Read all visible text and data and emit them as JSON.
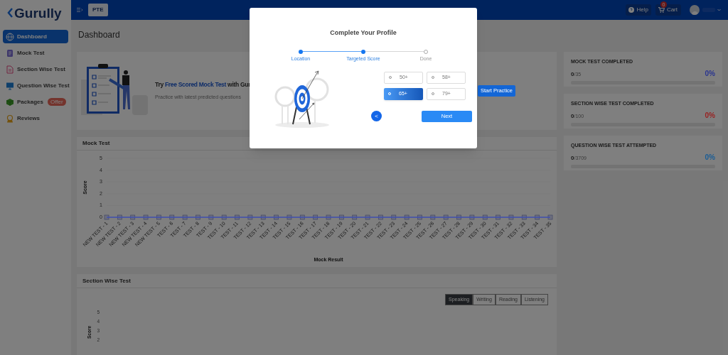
{
  "sidebar": {
    "logo": "Gurully",
    "items": [
      {
        "label": "Dashboard",
        "selected": true
      },
      {
        "label": "Mock Test",
        "selected": false
      },
      {
        "label": "Section Wise Test",
        "selected": false
      },
      {
        "label": "Question Wise Test",
        "selected": false
      },
      {
        "label": "Packages",
        "selected": false,
        "badge": "Offer"
      },
      {
        "label": "Reviews",
        "selected": false
      }
    ]
  },
  "header": {
    "exam_button": "PTE",
    "help": "Help",
    "cart": "Cart",
    "cart_count": "0"
  },
  "page_title": "Dashboard",
  "banner": {
    "title_before": "Try ",
    "title_highlight": "Free Scored Mock Test",
    "title_after": " with Gur",
    "subtitle": "Practice with latest predicted questions",
    "button": "Start Practice"
  },
  "stats": [
    {
      "title": "MOCK TEST COMPLETED",
      "value": "0",
      "total": "/35",
      "percent": "0%",
      "color": "#2a3590",
      "level": 0
    },
    {
      "title": "SECTION WISE TEST COMPLETED",
      "value": "0",
      "total": "/100",
      "percent": "0%",
      "color": "#9a1f1f",
      "level": 0
    },
    {
      "title": "QUESTION WISE TEST ATTEMPTED",
      "value": "0",
      "total": "/3709",
      "percent": "0%",
      "color": "#1a5d96",
      "level": 0
    }
  ],
  "mock_test": {
    "title": "Mock Test",
    "chart_data": {
      "type": "line",
      "xlabel": "Mock Result",
      "ylabel": "Score",
      "ylim": [
        0,
        5
      ],
      "yticks": [
        0,
        1,
        2,
        3,
        4,
        5
      ],
      "categories": [
        "NEW TEST - 1",
        "NEW TEST - 2",
        "NEW TEST - 3",
        "NEW TEST - 4",
        "NEW TEST - 5",
        "TEST - 6",
        "TEST - 7",
        "TEST - 8",
        "TEST - 9",
        "TEST - 10",
        "TEST - 11",
        "TEST - 12",
        "TEST - 13",
        "TEST - 14",
        "TEST - 15",
        "TEST - 16",
        "TEST - 17",
        "TEST - 18",
        "TEST - 19",
        "TEST - 20",
        "TEST - 21",
        "TEST - 22",
        "TEST - 23",
        "TEST - 24",
        "TEST - 25",
        "TEST - 26",
        "TEST - 27",
        "TEST - 28",
        "TEST - 29",
        "TEST - 30",
        "TEST - 31",
        "TEST - 32",
        "TEST - 33",
        "TEST - 34",
        "TEST - 35"
      ],
      "series": [
        {
          "color": "#3f4fb0",
          "marker": "square",
          "values": [
            0,
            0,
            0,
            0,
            0,
            0,
            0,
            0,
            0,
            0,
            0,
            0,
            0,
            0,
            0,
            0,
            0,
            0,
            0,
            0,
            0,
            0,
            0,
            0,
            0,
            0,
            0,
            0,
            0,
            0,
            0,
            0,
            0,
            0,
            0
          ]
        }
      ]
    }
  },
  "section_wise": {
    "title": "Section Wise Test",
    "tabs": [
      {
        "label": "Speaking",
        "selected": true
      },
      {
        "label": "Writing",
        "selected": false
      },
      {
        "label": "Reading",
        "selected": false
      },
      {
        "label": "Listening",
        "selected": false
      }
    ],
    "ylabel": "Score",
    "y_ticks": [
      "5",
      "4",
      "3",
      "2"
    ]
  },
  "modal": {
    "title": "Complete Your Profile",
    "steps": [
      {
        "label": "Location",
        "reached": true
      },
      {
        "label": "Targeted Score",
        "reached": true
      },
      {
        "label": "Done",
        "reached": false
      }
    ],
    "options": [
      {
        "label": "50+",
        "selected": false
      },
      {
        "label": "58+",
        "selected": false
      },
      {
        "label": "65+",
        "selected": true
      },
      {
        "label": "79+",
        "selected": false
      }
    ],
    "back_button": "<",
    "next_button": "Next"
  }
}
